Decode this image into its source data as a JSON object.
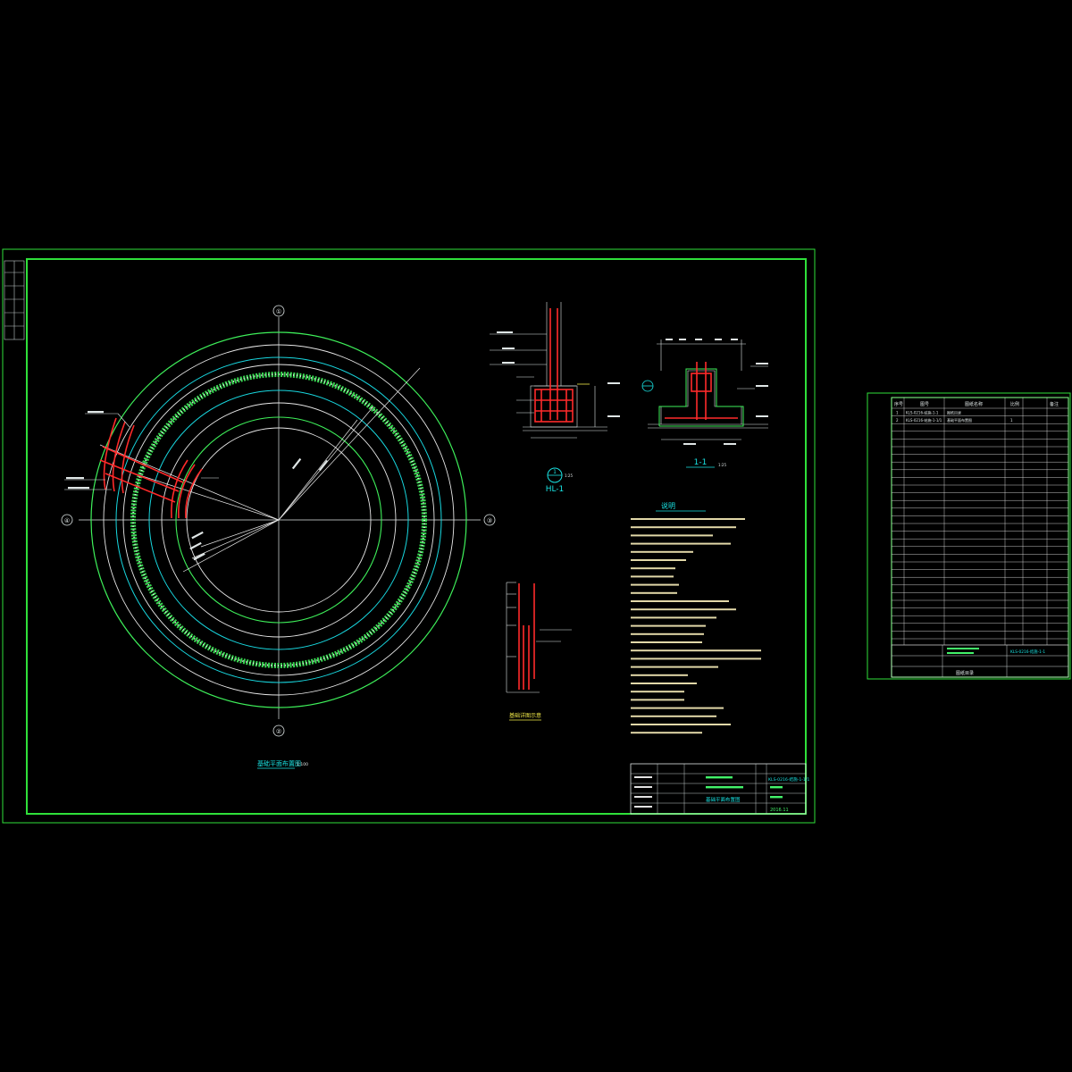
{
  "colors": {
    "background": "#000000",
    "frame": "#2fe03a",
    "ring_white": "#e8e8e8",
    "ring_cyan": "#18d8e0",
    "ring_green": "#3ef05a",
    "rebar": "#ff2a2a",
    "text": "#dfe6e6",
    "accent_yellow": "#f2ea49"
  },
  "plan": {
    "axis_top": "①",
    "axis_bottom": "②",
    "axis_left": "④",
    "axis_right": "③",
    "caption": "基础平面布置图",
    "caption_scale": "1:100"
  },
  "section_hl": {
    "marker": "1",
    "marker_scale": "1:25",
    "title": "HL-1"
  },
  "section_11": {
    "title": "1-1",
    "scale": "1:25"
  },
  "detail": {
    "caption": "基础详图示意"
  },
  "notes": {
    "title": "说明"
  },
  "title_block": {
    "drawing_no": "KLS-0216-结施-1-1/1",
    "drawing_title": "基础平面布置图",
    "date": "2016.11"
  },
  "index_sheet": {
    "header": [
      "序号",
      "图号",
      "图纸名称",
      "比例",
      "备注"
    ],
    "rows": [
      [
        "1",
        "KLS-0216-结施-1-1",
        "图纸目录",
        "",
        ""
      ],
      [
        "2",
        "KLS-0216-结施-1-1/1",
        "基础平面布置图",
        "1",
        ""
      ]
    ],
    "footer_drawing_no": "KLS-0216-结施-1-1",
    "footer_title": "图纸目录"
  }
}
